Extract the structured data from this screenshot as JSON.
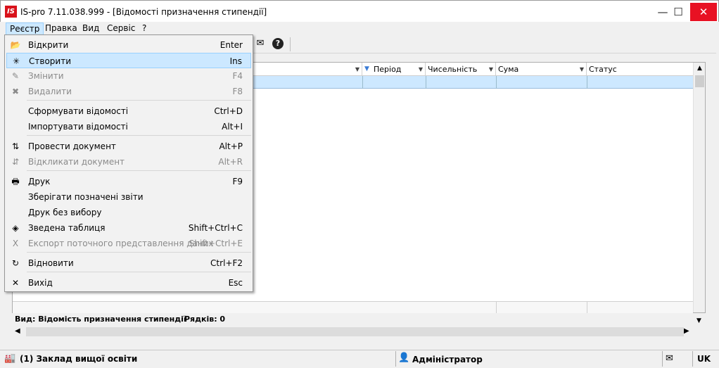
{
  "window": {
    "logo": "IS",
    "title": "IS-pro 7.11.038.999 - [Відомості призначення стипендії]",
    "min_glyph": "—",
    "max_glyph": "☐",
    "close_glyph": "✕"
  },
  "menubar": {
    "items": [
      "Реєстр",
      "Правка",
      "Вид",
      "Сервіс",
      "?"
    ]
  },
  "toolbar": {
    "mail_icon": "✉",
    "help_icon": "?"
  },
  "grid": {
    "columns": [
      "Період",
      "Чисельність",
      "Сума",
      "Статус"
    ],
    "rows": [],
    "view_label": "Вид: Відомість призначення стипендії",
    "rows_label": "Рядків: 0"
  },
  "dropdown": {
    "items": [
      {
        "label": "Відкрити",
        "shortcut": "Enter",
        "icon": "open-folder-icon",
        "glyph": "📂",
        "enabled": true
      },
      {
        "label": "Створити",
        "shortcut": "Ins",
        "icon": "new-document-icon",
        "glyph": "✳",
        "enabled": true,
        "highlighted": true
      },
      {
        "label": "Змінити",
        "shortcut": "F4",
        "icon": "edit-icon",
        "glyph": "✎",
        "enabled": false
      },
      {
        "label": "Видалити",
        "shortcut": "F8",
        "icon": "delete-icon",
        "glyph": "✖",
        "enabled": false
      },
      {
        "label": "Сформувати відомості",
        "shortcut": "Ctrl+D",
        "enabled": true
      },
      {
        "label": "Імпортувати відомості",
        "shortcut": "Alt+I",
        "enabled": true
      },
      {
        "label": "Провести документ",
        "shortcut": "Alt+P",
        "icon": "post-document-icon",
        "glyph": "⇅",
        "enabled": true
      },
      {
        "label": "Відкликати документ",
        "shortcut": "Alt+R",
        "icon": "revoke-document-icon",
        "glyph": "⇵",
        "enabled": false
      },
      {
        "label": "Друк",
        "shortcut": "F9",
        "icon": "printer-icon",
        "glyph": "🖶",
        "enabled": true
      },
      {
        "label": "Зберігати позначені звіти",
        "shortcut": "",
        "enabled": true
      },
      {
        "label": "Друк без вибору",
        "shortcut": "",
        "enabled": true
      },
      {
        "label": "Зведена таблиця",
        "shortcut": "Shift+Ctrl+C",
        "icon": "pivot-table-icon",
        "glyph": "◈",
        "enabled": true
      },
      {
        "label": "Експорт поточного представлення даних",
        "shortcut": "Shift+Ctrl+E",
        "icon": "excel-export-icon",
        "glyph": "X",
        "enabled": false
      },
      {
        "label": "Відновити",
        "shortcut": "Ctrl+F2",
        "icon": "refresh-icon",
        "glyph": "↻",
        "enabled": true
      },
      {
        "label": "Вихід",
        "shortcut": "Esc",
        "icon": "exit-icon",
        "glyph": "✕",
        "enabled": true
      }
    ]
  },
  "statusbar": {
    "organization": "(1) Заклад вищої освіти",
    "user": "Адміністратор",
    "language": "UK",
    "org_icon": "🏭",
    "user_icon": "👤",
    "mail_icon": "✉"
  },
  "colors": {
    "highlight": "#cce8ff",
    "highlight_border": "#99d1ff",
    "close_button": "#e81123",
    "logo": "#d9121b",
    "selected_row": "#cde8ff"
  }
}
